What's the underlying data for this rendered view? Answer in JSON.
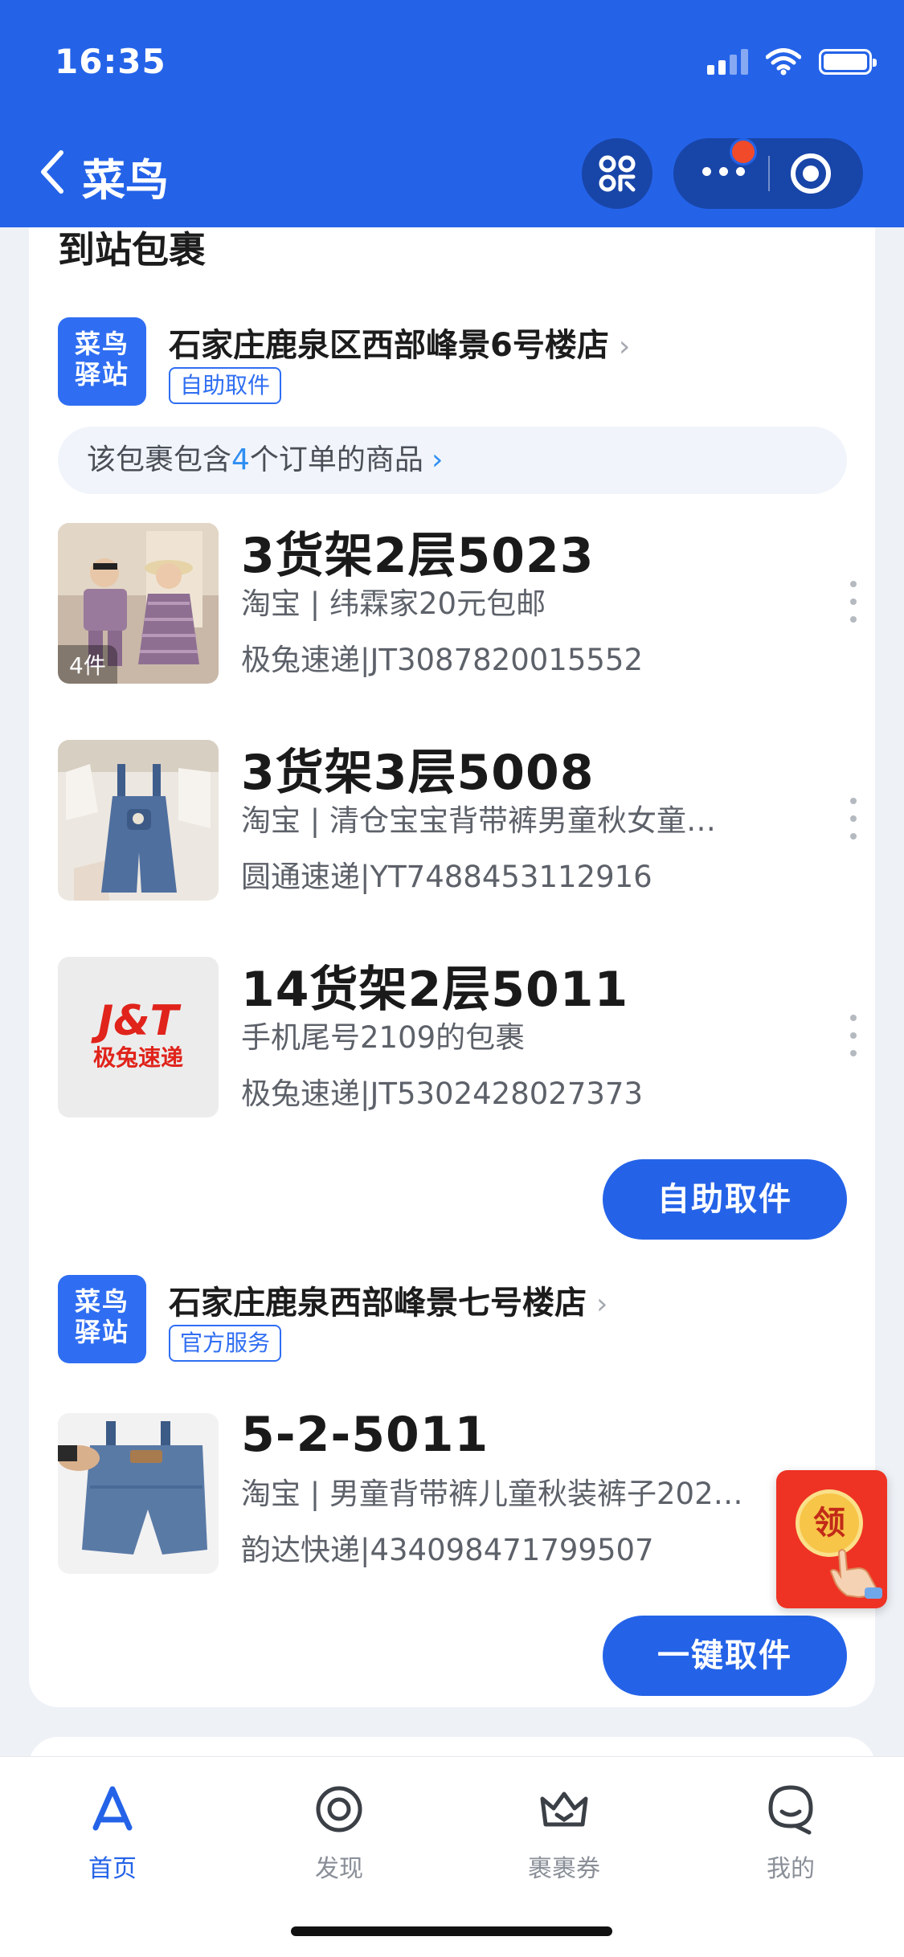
{
  "status_bar": {
    "time": "16:35"
  },
  "nav": {
    "title": "菜鸟",
    "back_icon": "chevron-left-icon",
    "scan_icon": "scan-icon",
    "more_icon": "more-icon",
    "close_icon": "target-icon"
  },
  "section": {
    "title": "到站包裹"
  },
  "stations": [
    {
      "logo": "菜鸟驿站",
      "name": "石家庄鹿泉区西部峰景6号楼店",
      "chevron": "›",
      "tag": "自助取件",
      "notice": {
        "prefix": "该包裹包含",
        "count": "4",
        "suffix": "个订单的商品",
        "chevron": "›"
      },
      "packages": [
        {
          "code": "3货架2层5023",
          "desc": "淘宝 | 纬霖家20元包邮",
          "carrier": "极兔速递|JT3087820015552",
          "thumb_count": "4件"
        },
        {
          "code": "3货架3层5008",
          "desc": "淘宝 | 清仓宝宝背带裤男童秋女童…",
          "carrier": "圆通速递|YT7488453112916"
        },
        {
          "code": "14货架2层5011",
          "desc": "手机尾号2109的包裹",
          "carrier": "极兔速递|JT5302428027373",
          "logo_brand": "J&T",
          "logo_sub": "极兔速递"
        }
      ],
      "action": "自助取件"
    },
    {
      "logo": "菜鸟驿站",
      "name": "石家庄鹿泉西部峰景七号楼店",
      "chevron": "›",
      "tag": "官方服务",
      "packages": [
        {
          "code": "5-2-5011",
          "desc": "淘宝 | 男童背带裤儿童秋装裤子202…",
          "carrier": "韵达快递|434098471799507"
        }
      ],
      "action": "一键取件"
    }
  ],
  "floating_badge": {
    "text": "领"
  },
  "tabbar": [
    {
      "label": "首页",
      "icon": "home-icon",
      "active": true
    },
    {
      "label": "发现",
      "icon": "discover-icon",
      "active": false
    },
    {
      "label": "裹裹券",
      "icon": "coupon-icon",
      "active": false
    },
    {
      "label": "我的",
      "icon": "profile-icon",
      "active": false
    }
  ],
  "colors": {
    "brand": "#2463e8",
    "accent_text": "#2f8ef2",
    "badge_red": "#ee3324"
  }
}
